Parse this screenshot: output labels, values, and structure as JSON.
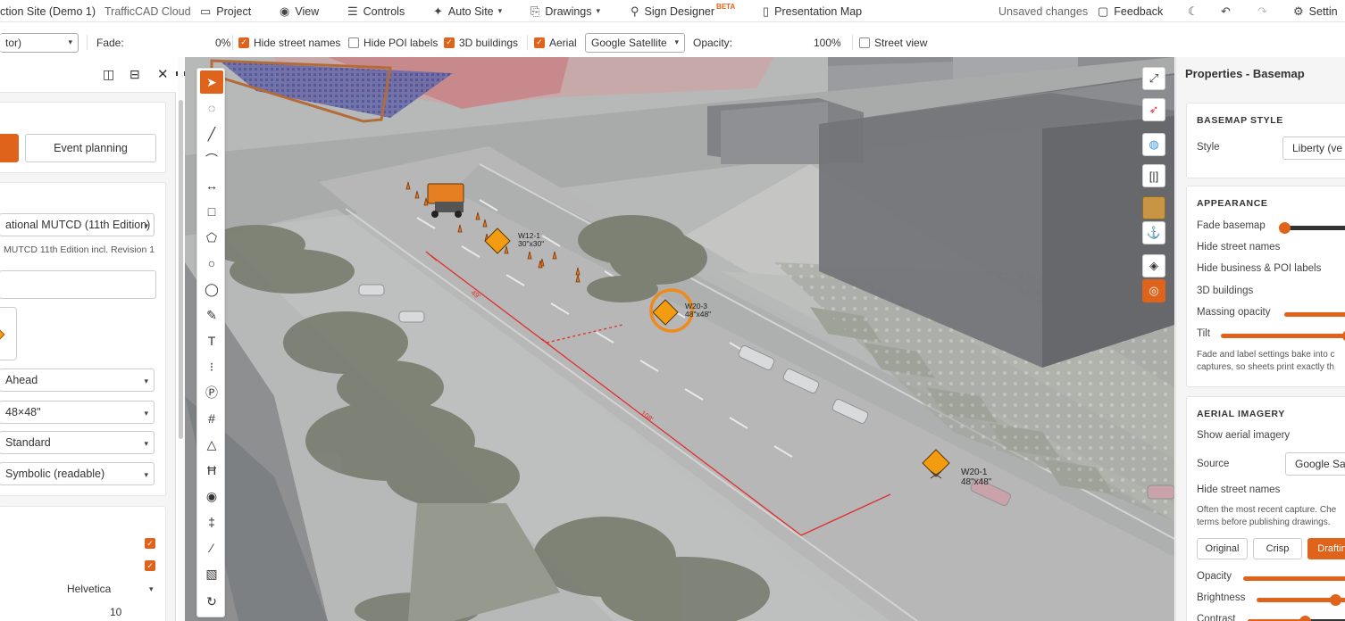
{
  "topbar": {
    "site_name": "ction Site (Demo 1)",
    "brand": "TrafficCAD Cloud",
    "menu": {
      "project": "Project",
      "view": "View",
      "controls": "Controls",
      "auto_site": "Auto Site",
      "drawings": "Drawings",
      "sign_designer": "Sign Designer",
      "sign_designer_badge": "BETA",
      "presentation_map": "Presentation Map"
    },
    "status": "Unsaved changes",
    "feedback": "Feedback",
    "settings": "Settin"
  },
  "toolbar": {
    "mode_select": "tor)",
    "fade_label": "Fade:",
    "fade_value": "0%",
    "fade_level": 0,
    "hide_street_names": {
      "label": "Hide street names",
      "checked": true
    },
    "hide_poi_labels": {
      "label": "Hide POI labels",
      "checked": false
    },
    "buildings_3d": {
      "label": "3D buildings",
      "checked": true
    },
    "aerial": {
      "label": "Aerial",
      "checked": true
    },
    "imagery_source": "Google Satellite",
    "opacity_label": "Opacity:",
    "opacity_value": "100%",
    "opacity_level": 100,
    "street_view": {
      "label": "Street view",
      "checked": false
    }
  },
  "left_panel": {
    "planning_button": "Event planning",
    "standard_select": "ational MUTCD (11th Edition)",
    "standard_note": "MUTCD 11th Edition incl. Revision 1",
    "selects": [
      "Ahead",
      "48×48\"",
      "Standard",
      "Symbolic (readable)"
    ],
    "font_value": "Helvetica",
    "size_value": "10"
  },
  "map": {
    "signs": [
      {
        "code": "W12-1",
        "size": "30\"x30\""
      },
      {
        "code": "W20-3",
        "size": "48\"x48\""
      },
      {
        "code": "W20-1",
        "size": "48\"x48\""
      }
    ]
  },
  "right_panel": {
    "title": "Properties - Basemap",
    "basemap_style": {
      "heading": "BASEMAP STYLE",
      "style_label": "Style",
      "style_value": "Liberty (ve"
    },
    "appearance": {
      "heading": "APPEARANCE",
      "fade_basemap": "Fade basemap",
      "hide_street_names": "Hide street names",
      "hide_poi_labels": "Hide business & POI labels",
      "buildings_3d": "3D buildings",
      "massing_opacity": "Massing opacity",
      "tilt": "Tilt",
      "note_line1": "Fade and label settings bake into c",
      "note_line2": "captures, so sheets print exactly th"
    },
    "aerial": {
      "heading": "AERIAL IMAGERY",
      "show_aerial": "Show aerial imagery",
      "source_label": "Source",
      "source_value": "Google Sat",
      "hide_street_names": "Hide street names",
      "note_line1": "Often the most recent capture. Che",
      "note_line2": "terms before publishing drawings.",
      "modes": [
        "Original",
        "Crisp",
        "Draftin"
      ],
      "opacity": "Opacity",
      "brightness": "Brightness",
      "contrast": "Contrast"
    }
  },
  "colors": {
    "accent": "#e0631b",
    "text": "#333333",
    "panel_bg": "#f5f5f5"
  }
}
